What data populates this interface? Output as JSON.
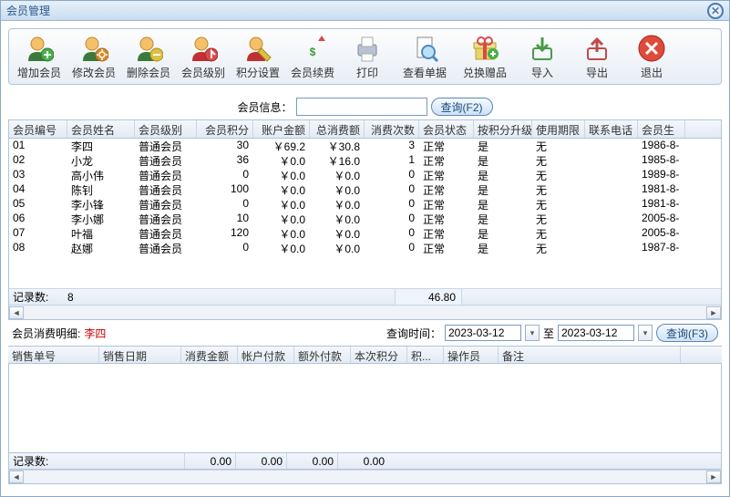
{
  "window": {
    "title": "会员管理"
  },
  "toolbar": {
    "add": "增加会员",
    "edit": "修改会员",
    "delete": "删除会员",
    "level": "会员级别",
    "points": "积分设置",
    "renew": "会员续费",
    "print": "打印",
    "bill": "查看单据",
    "gift": "兑换赠品",
    "import": "导入",
    "export": "导出",
    "exit": "退出"
  },
  "search": {
    "label": "会员信息：",
    "btn": "查询(F2)"
  },
  "members": {
    "columns": [
      "会员编号",
      "会员姓名",
      "会员级别",
      "会员积分",
      "账户金额",
      "总消费额",
      "消费次数",
      "会员状态",
      "按积分升级",
      "使用期限",
      "联系电话",
      "会员生"
    ],
    "rows": [
      {
        "id": "01",
        "name": "李四",
        "level": "普通会员",
        "points": "30",
        "balance": "￥69.2",
        "spend": "￥30.8",
        "count": "3",
        "status": "正常",
        "upgrade": "是",
        "expiry": "无",
        "phone": "",
        "birth": "1986-8-"
      },
      {
        "id": "02",
        "name": "小龙",
        "level": "普通会员",
        "points": "36",
        "balance": "￥0.0",
        "spend": "￥16.0",
        "count": "1",
        "status": "正常",
        "upgrade": "是",
        "expiry": "无",
        "phone": "",
        "birth": "1985-8-"
      },
      {
        "id": "03",
        "name": "高小伟",
        "level": "普通会员",
        "points": "0",
        "balance": "￥0.0",
        "spend": "￥0.0",
        "count": "0",
        "status": "正常",
        "upgrade": "是",
        "expiry": "无",
        "phone": "",
        "birth": "1989-8-"
      },
      {
        "id": "04",
        "name": "陈钊",
        "level": "普通会员",
        "points": "100",
        "balance": "￥0.0",
        "spend": "￥0.0",
        "count": "0",
        "status": "正常",
        "upgrade": "是",
        "expiry": "无",
        "phone": "",
        "birth": "1981-8-"
      },
      {
        "id": "05",
        "name": "李小锋",
        "level": "普通会员",
        "points": "0",
        "balance": "￥0.0",
        "spend": "￥0.0",
        "count": "0",
        "status": "正常",
        "upgrade": "是",
        "expiry": "无",
        "phone": "",
        "birth": "1981-8-"
      },
      {
        "id": "06",
        "name": "李小娜",
        "level": "普通会员",
        "points": "10",
        "balance": "￥0.0",
        "spend": "￥0.0",
        "count": "0",
        "status": "正常",
        "upgrade": "是",
        "expiry": "无",
        "phone": "",
        "birth": "2005-8-"
      },
      {
        "id": "07",
        "name": "叶福",
        "level": "普通会员",
        "points": "120",
        "balance": "￥0.0",
        "spend": "￥0.0",
        "count": "0",
        "status": "正常",
        "upgrade": "是",
        "expiry": "无",
        "phone": "",
        "birth": "2005-8-"
      },
      {
        "id": "08",
        "name": "赵娜",
        "level": "普通会员",
        "points": "0",
        "balance": "￥0.0",
        "spend": "￥0.0",
        "count": "0",
        "status": "正常",
        "upgrade": "是",
        "expiry": "无",
        "phone": "",
        "birth": "1987-8-"
      }
    ],
    "totals": {
      "label": "记录数:",
      "count": "8",
      "spend": "46.80"
    }
  },
  "detail": {
    "label": "会员消费明细:",
    "member": "李四",
    "timeLabel": "查询时间：",
    "from": "2023-03-12",
    "to": "2023-03-12",
    "toLabel": "至",
    "btn": "查询(F3)",
    "columns": [
      "销售单号",
      "销售日期",
      "消费金额",
      "帐户付款",
      "额外付款",
      "本次积分",
      "积...",
      "操作员",
      "备注"
    ],
    "totals": {
      "label": "记录数:",
      "count": "",
      "v1": "0.00",
      "v2": "0.00",
      "v3": "0.00",
      "v4": "0.00"
    }
  }
}
